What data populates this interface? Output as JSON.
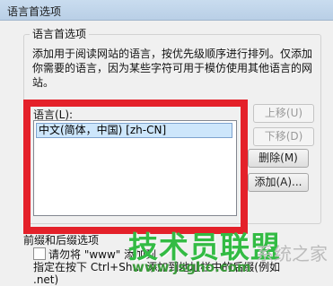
{
  "window": {
    "title": "语言首选项"
  },
  "group": {
    "legend": "语言首选项",
    "description": "添加用于阅读网站的语言，按优先级顺序进行排列。仅添加你需要的语言，因为某些字符可用于模仿使用其他语言的网站。"
  },
  "languages": {
    "label": "语言(L):",
    "items": [
      "中文(简体，中国) [zh-CN]"
    ]
  },
  "buttons": {
    "move_up": "上移(U)",
    "move_down": "下移(D)",
    "remove": "删除(M)",
    "add": "添加(A)..."
  },
  "bottom": {
    "legend": "前缀和后缀选项",
    "checkbox_label": "请勿将 \"www\" 添加到",
    "hint": "指定在按下 Ctrl+Sh… 添加到地址栏中的后缀(例如 .net)"
  },
  "watermark": {
    "text": "技术员联盟",
    "url": "www.jsgho.com",
    "side": "系统之家"
  },
  "colors": {
    "highlight": "#e4212a",
    "selection": "#cde6fb",
    "watermark": "#33bb44"
  }
}
